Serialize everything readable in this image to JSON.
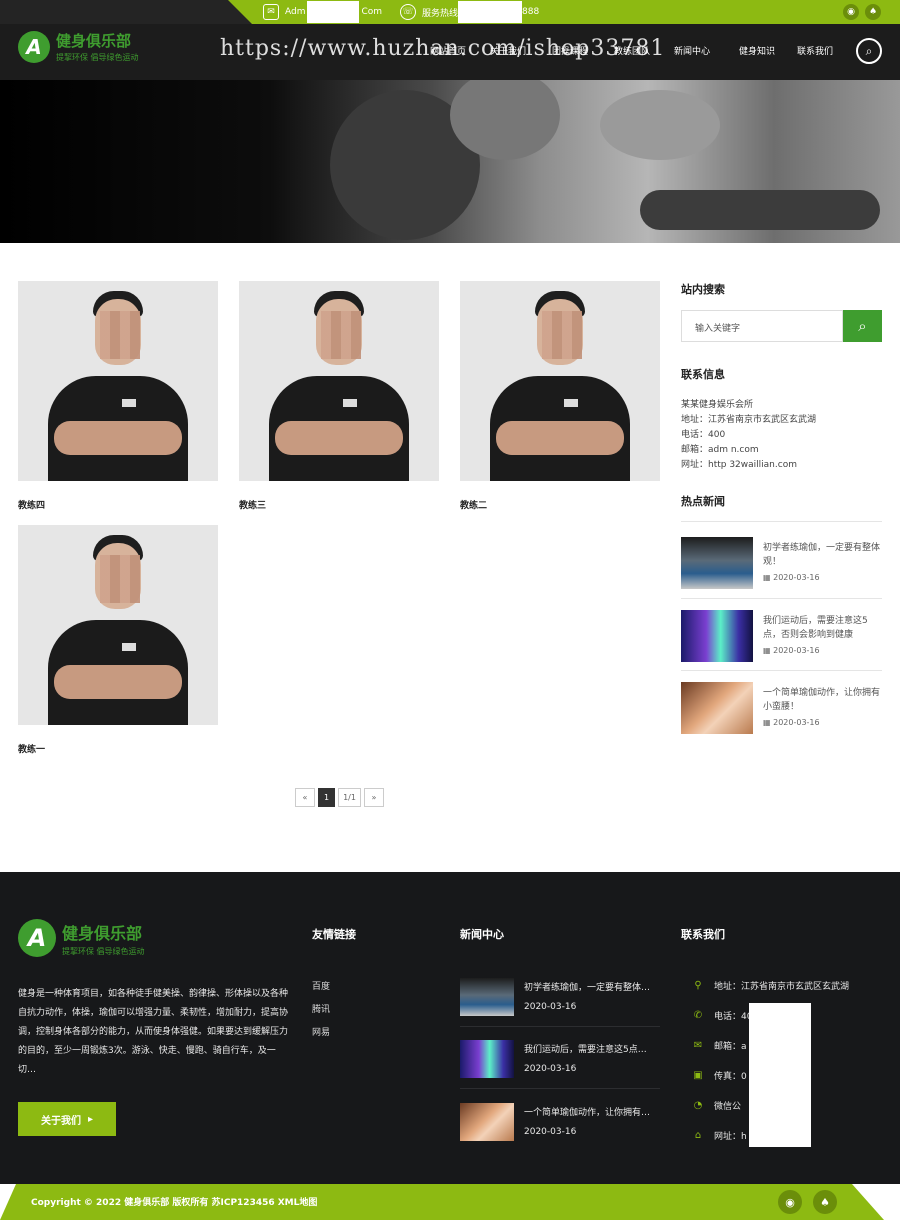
{
  "topbar": {
    "email_prefix": "Adm",
    "email_suffix": "Com",
    "phone_prefix": "服务热线",
    "phone_suffix": "888",
    "email_icon": "envelope-icon",
    "phone_icon": "phone-icon",
    "social": [
      "weibo-icon",
      "qq-icon"
    ]
  },
  "header": {
    "logo_title": "健身俱乐部",
    "logo_slogan": "提挈环保  倡导绿色运动",
    "watermark": "https://www.huzhan.com/ishop33781",
    "nav": [
      "网站首页",
      "关于我们",
      "团操课程",
      "教练团队",
      "新闻中心",
      "健身知识",
      "联系我们"
    ]
  },
  "coaches": [
    {
      "name": "教练四"
    },
    {
      "name": "教练三"
    },
    {
      "name": "教练二"
    },
    {
      "name": "教练一"
    }
  ],
  "pagination": {
    "prev": "«",
    "current": "1",
    "info": "1/1",
    "next": "»"
  },
  "sidebar": {
    "search_title": "站内搜索",
    "search_placeholder": "输入关键字",
    "contact_title": "联系信息",
    "contact_lines": [
      "某某健身娱乐会所",
      "地址：江苏省南京市玄武区玄武湖",
      "电话：400",
      "邮箱：adm                 n.com",
      "网址：http                32waillian.com"
    ],
    "news_title": "热点新闻",
    "news": [
      {
        "title": "初学者练瑜伽，一定要有整体观！",
        "date": "2020-03-16"
      },
      {
        "title": "我们运动后，需要注意这5点，否则会影响到健康",
        "date": "2020-03-16"
      },
      {
        "title": "一个简单瑜伽动作，让你拥有小蛮腰！",
        "date": "2020-03-16"
      }
    ]
  },
  "footer": {
    "logo_title": "健身俱乐部",
    "logo_slogan": "提挈环保  倡导绿色运动",
    "about": "健身是一种体育项目，如各种徒手健美操、韵律操、形体操以及各种自抗力动作，体操，瑜伽可以增强力量、柔韧性，增加耐力，提高协调，控制身体各部分的能力，从而使身体强健。如果要达到缓解压力的目的，至少一周锻炼3次。游泳、快走、慢跑、骑自行车，及一切…",
    "more_label": "关于我们",
    "links_title": "友情链接",
    "links": [
      "百度",
      "腾讯",
      "网易"
    ],
    "news_title": "新闻中心",
    "news": [
      {
        "title": "初学者练瑜伽，一定要有整体…",
        "date": "2020-03-16"
      },
      {
        "title": "我们运动后，需要注意这5点…",
        "date": "2020-03-16"
      },
      {
        "title": "一个简单瑜伽动作，让你拥有…",
        "date": "2020-03-16"
      }
    ],
    "contact_title": "联系我们",
    "contacts": [
      {
        "icon": "location-icon",
        "text": "地址：江苏省南京市玄武区玄武湖"
      },
      {
        "icon": "phone-icon",
        "text": "电话：40"
      },
      {
        "icon": "mail-icon",
        "text": "邮箱：a                com"
      },
      {
        "icon": "fax-icon",
        "text": "传真：0"
      },
      {
        "icon": "wechat-icon",
        "text": "微信公"
      },
      {
        "icon": "home-icon",
        "text": "网址：h               2waillian.com"
      }
    ],
    "copyright": "Copyright © 2022 健身俱乐部 版权所有 苏ICP123456 XML地图"
  },
  "colors": {
    "accent": "#8dba12",
    "brand_green": "#3f9d2f",
    "footer_bg": "#17181a",
    "header_bg": "#1c1c1c"
  }
}
